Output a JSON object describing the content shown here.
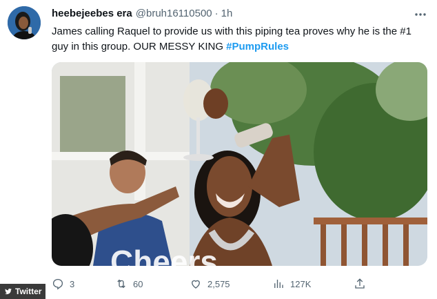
{
  "tweet": {
    "display_name": "heebejeebes era",
    "handle": "@bruh16110500",
    "separator": "·",
    "time": "1h",
    "text_main": "James calling Raquel to provide us with this piping tea proves why he is the #1 guy in this group. OUR MESSY KING ",
    "hashtag": "#PumpRules",
    "more_icon": "more-horizontal-icon"
  },
  "media": {
    "caption_overlay": "Cheers"
  },
  "actions": {
    "reply_count": "3",
    "retweet_count": "60",
    "like_count": "2,575",
    "views_count": "127K",
    "icons": [
      "reply-icon",
      "retweet-icon",
      "like-icon",
      "views-icon",
      "share-icon"
    ]
  },
  "watermark": {
    "label": "Twitter"
  },
  "colors": {
    "accent": "#1d9bf0",
    "secondary_text": "#536471",
    "primary_text": "#0f1419"
  }
}
